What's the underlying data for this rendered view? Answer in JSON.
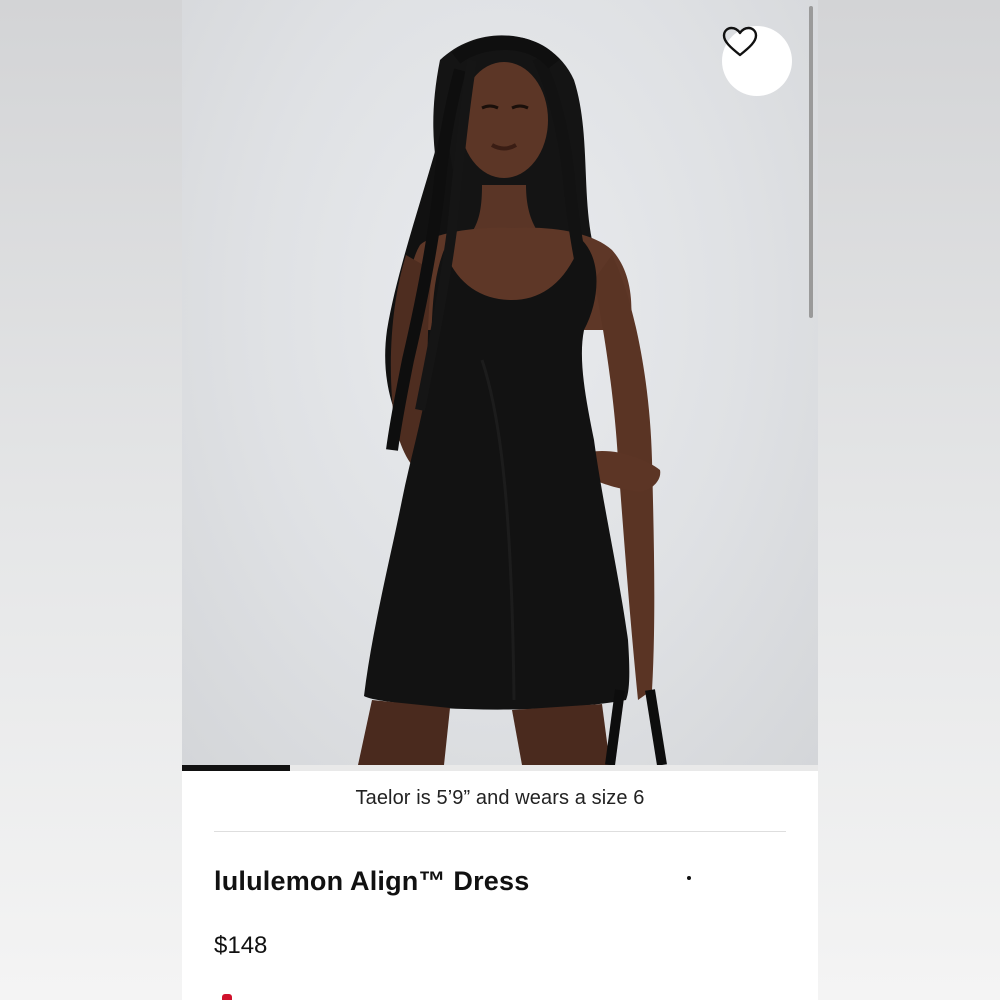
{
  "product": {
    "image_alt": "Model wearing black sleeveless lululemon Align Dress",
    "model_caption": "Taelor is 5’9” and wears a size 6",
    "title": "lululemon Align™ Dress",
    "price": "$148"
  },
  "gallery": {
    "progress_fraction": 0.17
  },
  "icons": {
    "favorite": "heart-outline-icon"
  },
  "colors": {
    "text": "#111111",
    "background": "#ffffff",
    "progress": "#111111",
    "accent_red": "#d0122c"
  }
}
